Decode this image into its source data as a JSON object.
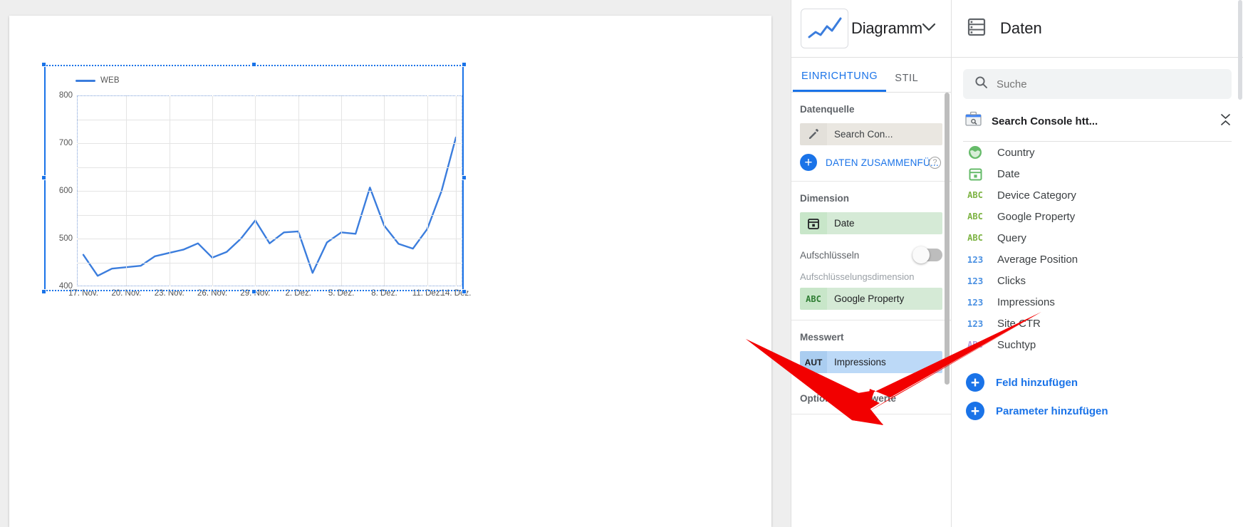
{
  "properties_panel": {
    "chart_type_label": "Diagramm",
    "chart_type_icon": "line-chart-icon",
    "caret_icon": "chevron-down-icon",
    "tabs": [
      {
        "label": "EINRICHTUNG",
        "active": true
      },
      {
        "label": "STIL",
        "active": false
      }
    ],
    "datasource": {
      "title": "Datenquelle",
      "chip_icon": "pencil-icon",
      "chip_text": "Search Con...",
      "add_link": "DATEN ZUSAMMENFÜ...",
      "add_icon": "plus-circle-icon",
      "help_icon": "help-circle-icon"
    },
    "dimension": {
      "title": "Dimension",
      "chip_icon": "calendar-icon",
      "chip_text": "Date",
      "breakdown_toggle_label": "Aufschlüsseln",
      "breakdown_toggle_state": "off",
      "breakdown_sub_label": "Aufschlüsselungsdimension",
      "breakdown_chip_icon": "ABC",
      "breakdown_chip_text": "Google Property"
    },
    "metric": {
      "title": "Messwert",
      "chip_icon": "AUT",
      "chip_text": "Impressions",
      "optional_title": "Optionale Messwerte"
    }
  },
  "data_panel": {
    "title": "Daten",
    "title_icon": "data-list-icon",
    "search": {
      "placeholder": "Suche",
      "icon": "search-icon"
    },
    "source": {
      "name": "Search Console htt...",
      "icon": "search-console-icon",
      "collapse_icon": "collapse-expand-icon"
    },
    "fields": [
      {
        "label": "Country",
        "icon": "globe-icon",
        "type": "geo"
      },
      {
        "label": "Date",
        "icon": "calendar-icon",
        "type": "date"
      },
      {
        "label": "Device Category",
        "icon": "ABC",
        "type": "text"
      },
      {
        "label": "Google Property",
        "icon": "ABC",
        "type": "text"
      },
      {
        "label": "Query",
        "icon": "ABC",
        "type": "text"
      },
      {
        "label": "Average Position",
        "icon": "123",
        "type": "number"
      },
      {
        "label": "Clicks",
        "icon": "123",
        "type": "number"
      },
      {
        "label": "Impressions",
        "icon": "123",
        "type": "number"
      },
      {
        "label": "Site CTR",
        "icon": "123",
        "type": "number"
      },
      {
        "label": "Suchtyp",
        "icon": "ABC",
        "type": "text-purple"
      }
    ],
    "add_links": [
      {
        "label": "Feld hinzufügen",
        "icon": "plus-circle-icon"
      },
      {
        "label": "Parameter hinzufügen",
        "icon": "plus-circle-icon"
      }
    ]
  },
  "colors": {
    "accent": "#1a73e8",
    "chart_line": "#3b7ddd",
    "arrow": "#f20000",
    "chip_green": "#d5ead6",
    "chip_blue": "#bcd9f7",
    "chip_grey": "#eae7e1"
  },
  "chart_data": {
    "type": "line",
    "title": "",
    "legend": [
      "WEB"
    ],
    "legend_position": "top-left",
    "grid": true,
    "xlabel": "",
    "ylabel": "",
    "ylim": [
      400,
      800
    ],
    "yticks": [
      400,
      500,
      600,
      700,
      800
    ],
    "xticks": [
      "17. Nov.",
      "20. Nov.",
      "23. Nov.",
      "26. Nov.",
      "29. Nov.",
      "2. Dez.",
      "5. Dez.",
      "8. Dez.",
      "11. Dez.",
      "14. Dez."
    ],
    "x": [
      "17. Nov.",
      "18. Nov.",
      "19. Nov.",
      "20. Nov.",
      "21. Nov.",
      "22. Nov.",
      "23. Nov.",
      "24. Nov.",
      "25. Nov.",
      "26. Nov.",
      "27. Nov.",
      "28. Nov.",
      "29. Nov.",
      "30. Nov.",
      "1. Dez.",
      "2. Dez.",
      "3. Dez.",
      "4. Dez.",
      "5. Dez.",
      "6. Dez.",
      "7. Dez.",
      "8. Dez.",
      "9. Dez.",
      "10. Dez.",
      "11. Dez.",
      "12. Dez.",
      "13. Dez."
    ],
    "series": [
      {
        "name": "WEB",
        "color": "#3b7ddd",
        "values": [
          466,
          422,
          437,
          440,
          443,
          463,
          470,
          477,
          490,
          460,
          472,
          500,
          538,
          490,
          513,
          515,
          428,
          492,
          513,
          510,
          607,
          527,
          489,
          479,
          520,
          600,
          712
        ]
      }
    ]
  }
}
